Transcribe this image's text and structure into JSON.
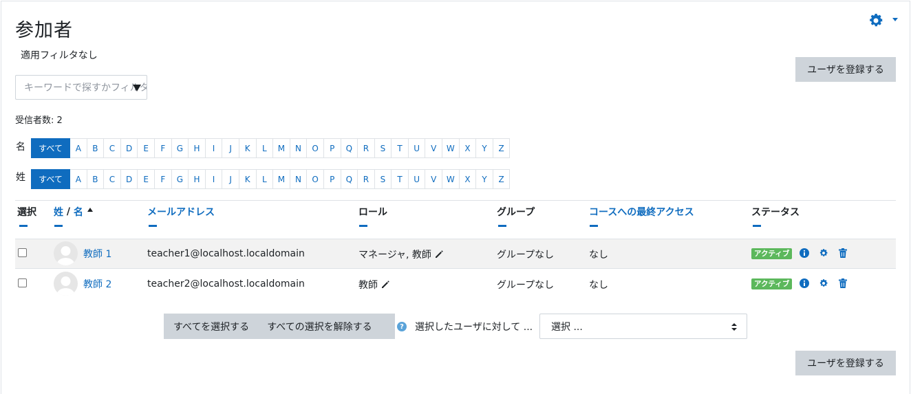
{
  "page": {
    "title": "参加者",
    "filter_status": "適用フィルタなし",
    "enrol_button_label": "ユーザを登録する",
    "search_placeholder": "キーワードで探すかフィルタを選択する",
    "recipient_count": "受信者数: 2"
  },
  "initials_bar": {
    "first_name_label": "名",
    "last_name_label": "姓",
    "all_label": "すべて",
    "letters": [
      "A",
      "B",
      "C",
      "D",
      "E",
      "F",
      "G",
      "H",
      "I",
      "J",
      "K",
      "L",
      "M",
      "N",
      "O",
      "P",
      "Q",
      "R",
      "S",
      "T",
      "U",
      "V",
      "W",
      "X",
      "Y",
      "Z"
    ],
    "active": "すべて"
  },
  "table": {
    "headers": {
      "select": "選択",
      "last_name": "姓",
      "separator": " / ",
      "first_name": "名",
      "email": "メールアドレス",
      "role": "ロール",
      "group": "グループ",
      "last_access": "コースへの最終アクセス",
      "status": "ステータス"
    },
    "rows": [
      {
        "name": "教師 1",
        "email": "teacher1@localhost.localdomain",
        "role": "マネージャ, 教師",
        "group": "グループなし",
        "last_access": "なし",
        "status": "アクティブ"
      },
      {
        "name": "教師 2",
        "email": "teacher2@localhost.localdomain",
        "role": "教師",
        "group": "グループなし",
        "last_access": "なし",
        "status": "アクティブ"
      }
    ]
  },
  "bulk": {
    "select_all": "すべてを選択する",
    "deselect_all": "すべての選択を解除する",
    "help_glyph": "?",
    "with_selected": "選択したユーザに対して ...",
    "select_value": "選択 ..."
  },
  "icons": {
    "settings": "gear-icon",
    "sort_asc": "sort-ascending-icon",
    "edit": "pencil-icon",
    "info": "info-icon",
    "manage": "gear-icon",
    "delete": "trash-icon"
  },
  "colors": {
    "link": "#0f6cbf",
    "active_badge": "#5cb85c",
    "button_grey": "#ced4da"
  }
}
